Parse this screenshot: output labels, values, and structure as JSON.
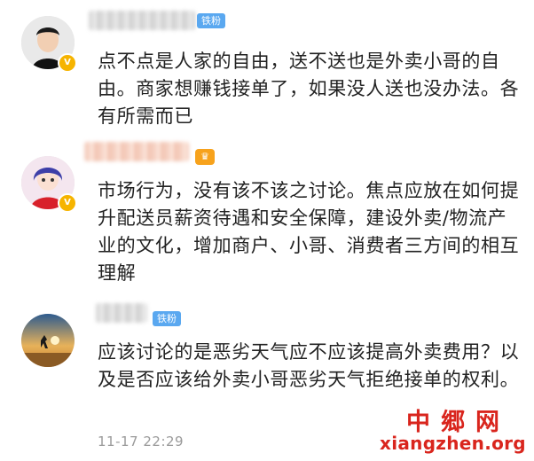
{
  "comments": [
    {
      "badge": "铁粉",
      "text": "点不点是人家的自由，送不送也是外卖小哥的自由。商家想赚钱接单了，如果没人送也没办法。各有所需而已"
    },
    {
      "badge": "",
      "text": "市场行为，没有该不该之讨论。焦点应放在如何提升配送员薪资待遇和安全保障，建设外卖/物流产业的文化，增加商户、小哥、消费者三方间的相互理解"
    },
    {
      "badge": "铁粉",
      "text": "应该讨论的是恶劣天气应不应该提高外卖费用？以及是否应该给外卖小哥恶劣天气拒绝接单的权利。",
      "time": "11-17 22:29"
    }
  ],
  "watermark": {
    "title": "中郷网",
    "url": "xiangzhen.org"
  },
  "colors": {
    "badge_blue": "#5aa8f0",
    "verified_gold": "#f6b400",
    "watermark_red": "#d9251d",
    "timestamp_gray": "#9a9a9a"
  },
  "icons": [
    "avatar",
    "verified-badge-icon",
    "vip-icon"
  ]
}
